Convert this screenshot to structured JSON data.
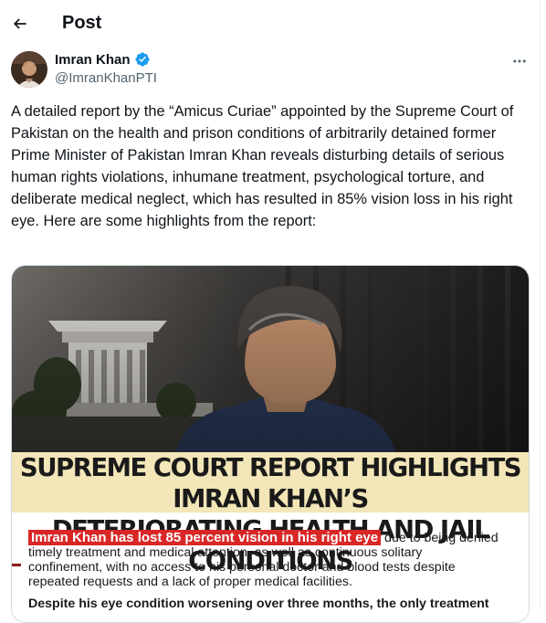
{
  "header": {
    "title": "Post",
    "back_icon": "arrow-left-icon"
  },
  "author": {
    "display_name": "Imran Khan",
    "handle": "@ImranKhanPTI",
    "verified_icon": "verified-badge-icon",
    "verified_color": "#1d9bf0"
  },
  "post": {
    "text": "A detailed report by the “Amicus Curiae” appointed by the Supreme Court of Pakistan on the health and prison conditions of arbitrarily detained former Prime Minister of Pakistan Imran Khan reveals disturbing details of serious human rights violations, inhumane treatment, psychological torture, and deliberate medical neglect, which has resulted in 85% vision loss in his right eye. Here are some highlights from the report:"
  },
  "media": {
    "headline_line1": "SUPREME COURT REPORT HIGHLIGHTS IMRAN KHAN’S",
    "headline_line2": "DETERIORATING HEALTH AND JAIL CONDITIONS",
    "highlight": "Imran Khan has lost 85 percent vision in his right eye",
    "line1_rest": " due to being denied",
    "line2": "timely treatment and medical attention, as well as continuous solitary",
    "line3": "confinement, with no access to his personal doctor and blood tests despite",
    "line4": "repeated requests and a lack of proper medical facilities.",
    "line5": "Despite his eye condition worsening over three months, the only treatment",
    "headline_bg": "#f3e6b8",
    "highlight_color": "#d92626"
  },
  "more_icon": "more-horizontal-icon"
}
